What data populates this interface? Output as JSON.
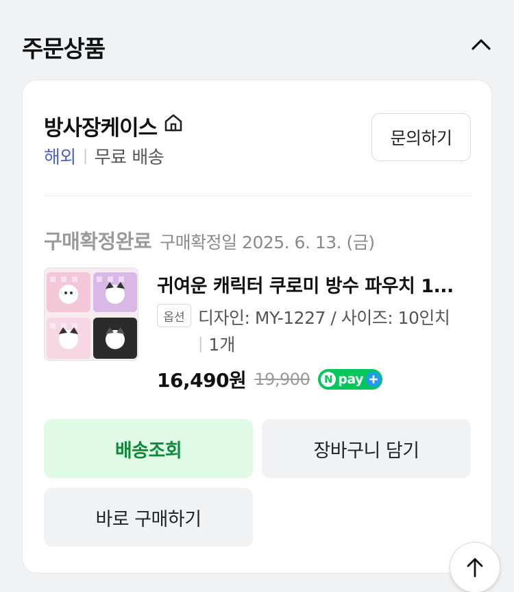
{
  "section": {
    "title": "주문상품"
  },
  "seller": {
    "name": "방사장케이스",
    "origin": "해외",
    "shipping": "무료 배송",
    "inquiry_label": "문의하기"
  },
  "order": {
    "status": "구매확정완료",
    "status_date": "구매확정일 2025. 6. 13. (금)"
  },
  "product": {
    "title": "귀여운 캐릭터 쿠로미 방수 파우치 1...",
    "option_badge": "옵션",
    "option_text": "디자인: MY-1227 / 사이즈: 10인치",
    "quantity": "1개",
    "price": "16,490원",
    "original_price": "19,900",
    "npay_n": "N",
    "npay_text": "pay"
  },
  "actions": {
    "track_label": "배송조회",
    "cart_label": "장바구니 담기",
    "buy_label": "바로 구매하기"
  },
  "colors": {
    "accent_green": "#03c75a",
    "track_text": "#0d8a3a",
    "track_bg": "#dffbe6",
    "link_blue": "#4f62c2"
  },
  "icons": {
    "collapse": "chevron-up-icon",
    "home": "home-icon",
    "scroll_top": "arrow-up-icon"
  }
}
